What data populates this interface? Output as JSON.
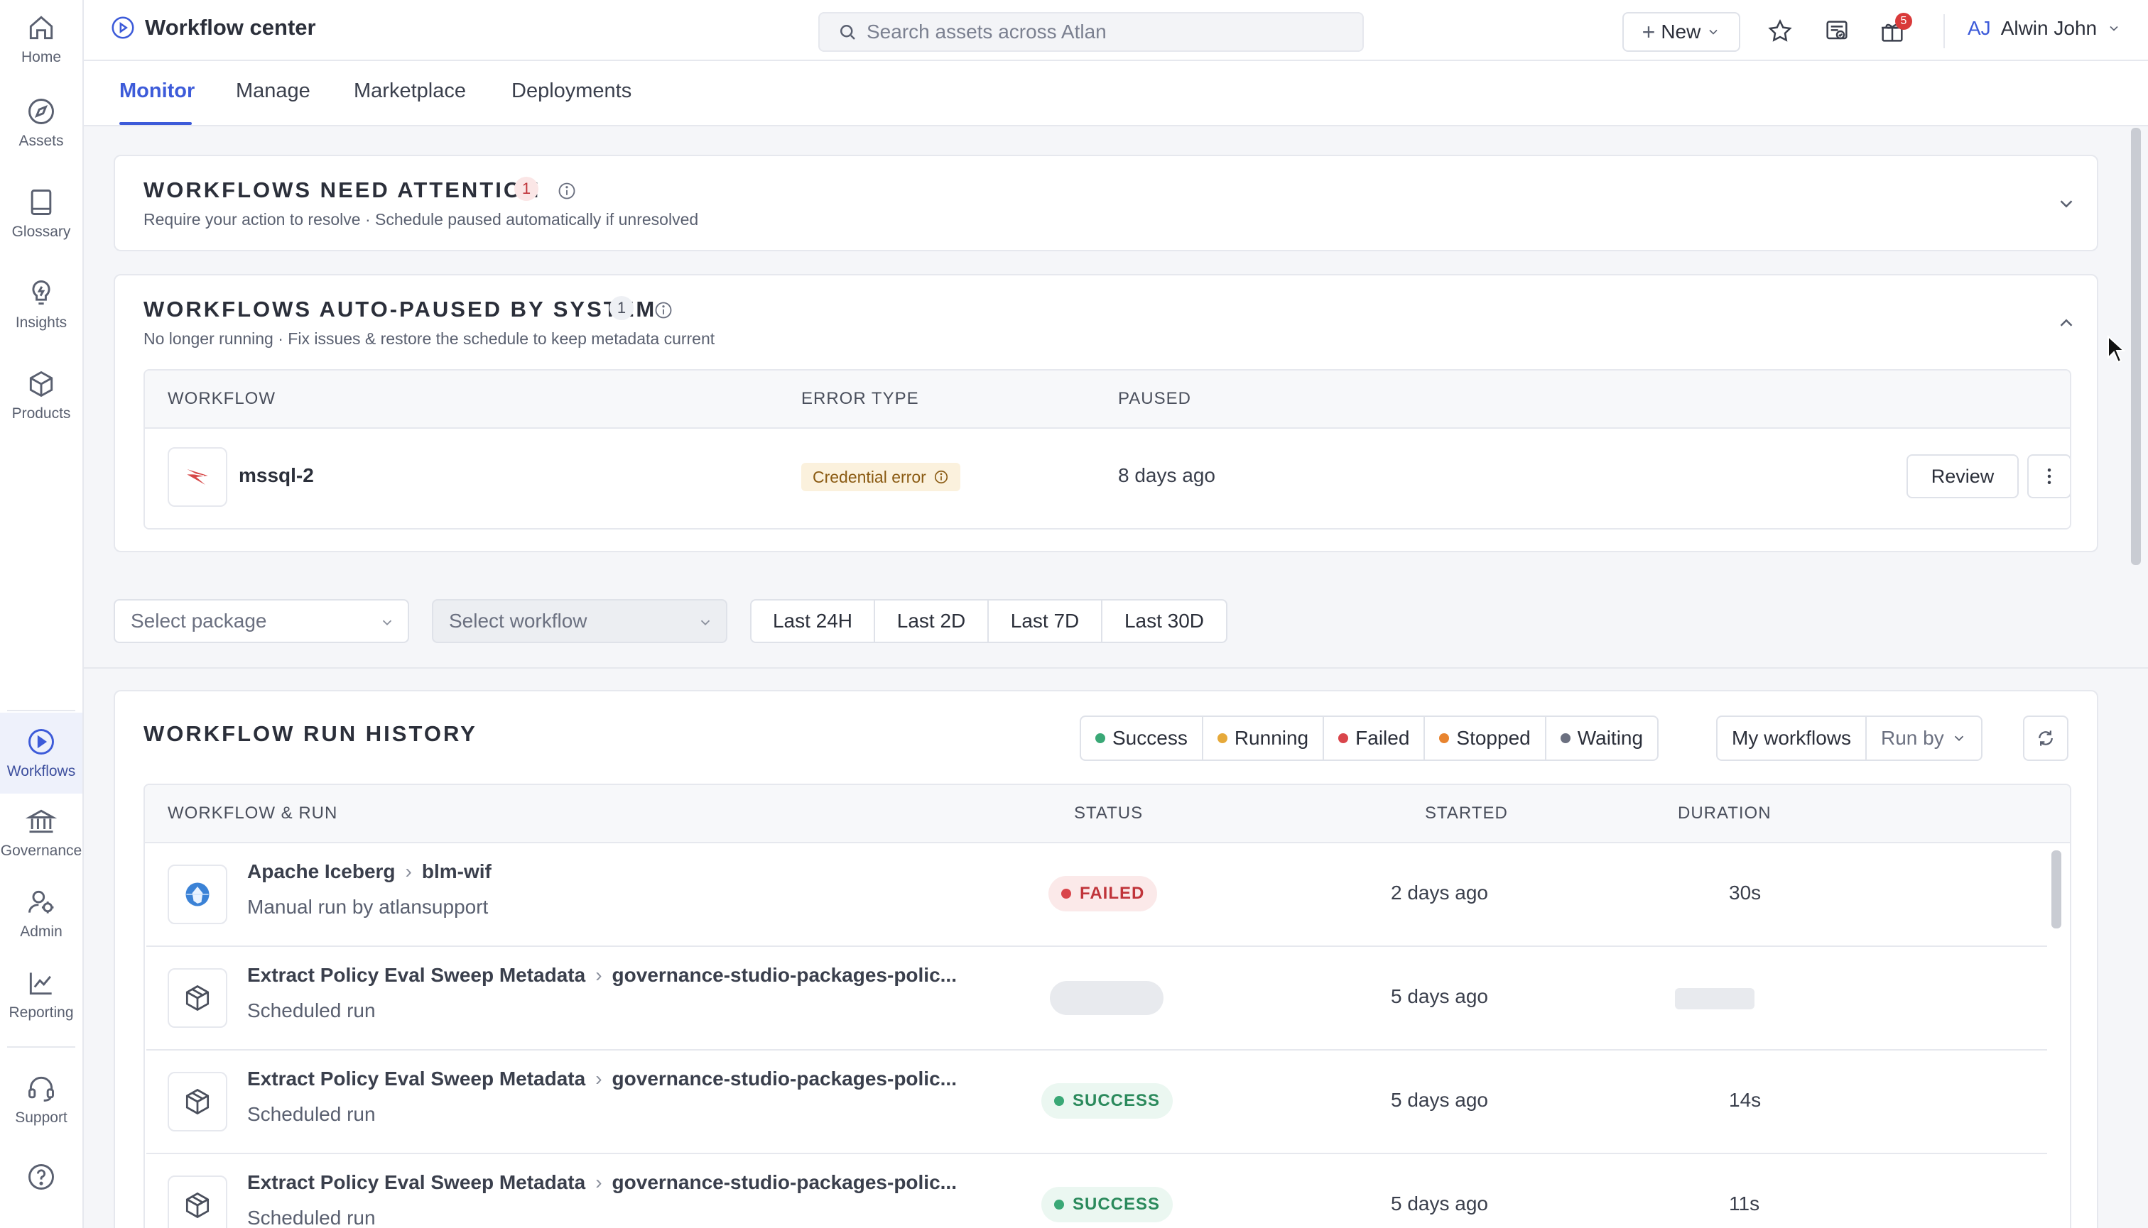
{
  "nav": {
    "top": [
      {
        "label": "Home",
        "icon": "home-icon"
      },
      {
        "label": "Assets",
        "icon": "compass-icon"
      },
      {
        "label": "Glossary",
        "icon": "book-icon"
      },
      {
        "label": "Insights",
        "icon": "lightbulb-icon"
      },
      {
        "label": "Products",
        "icon": "cube-icon"
      }
    ],
    "bottom": [
      {
        "label": "Workflows",
        "icon": "play-circle-icon",
        "active": true
      },
      {
        "label": "Governance",
        "icon": "bank-icon"
      },
      {
        "label": "Admin",
        "icon": "admin-icon"
      },
      {
        "label": "Reporting",
        "icon": "chart-line-icon"
      },
      {
        "label": "Support",
        "icon": "headset-icon"
      }
    ]
  },
  "header": {
    "title": "Workflow center",
    "search_placeholder": "Search assets across Atlan",
    "new_label": "New",
    "notification_count": "5",
    "user_initials": "AJ",
    "user_name": "Alwin John"
  },
  "tabs": [
    {
      "label": "Monitor",
      "active": true
    },
    {
      "label": "Manage"
    },
    {
      "label": "Marketplace"
    },
    {
      "label": "Deployments"
    }
  ],
  "attention": {
    "title": "WORKFLOWS NEED ATTENTION",
    "count": "1",
    "subtitle": "Require your action to resolve · Schedule paused automatically if unresolved"
  },
  "auto_paused": {
    "title": "WORKFLOWS AUTO-PAUSED BY SYSTEM",
    "count": "1",
    "subtitle": "No longer running · Fix issues & restore the schedule to keep metadata current",
    "columns": {
      "workflow": "WORKFLOW",
      "error": "ERROR TYPE",
      "paused": "PAUSED"
    },
    "row": {
      "name": "mssql-2",
      "error": "Credential error",
      "paused": "8 days ago",
      "action": "Review"
    }
  },
  "filters": {
    "package_placeholder": "Select package",
    "workflow_placeholder": "Select workflow",
    "ranges": [
      "Last 24H",
      "Last 2D",
      "Last 7D",
      "Last 30D"
    ]
  },
  "run_history": {
    "title": "WORKFLOW RUN HISTORY",
    "legend": [
      {
        "label": "Success",
        "color": "#3aa876"
      },
      {
        "label": "Running",
        "color": "#e6a93a"
      },
      {
        "label": "Failed",
        "color": "#d9454b"
      },
      {
        "label": "Stopped",
        "color": "#e8842f"
      },
      {
        "label": "Waiting",
        "color": "#6b7080"
      }
    ],
    "my_workflows": "My workflows",
    "run_by": "Run by",
    "columns": {
      "workflow": "WORKFLOW & RUN",
      "status": "STATUS",
      "started": "STARTED",
      "duration": "DURATION"
    },
    "rows": [
      {
        "package": "Apache Iceberg",
        "run": "blm-wif",
        "sub": "Manual run by atlansupport",
        "status": "FAILED",
        "started": "2 days ago",
        "duration": "30s",
        "icon": "iceberg-icon"
      },
      {
        "package": "Extract Policy Eval Sweep Metadata",
        "run": "governance-studio-packages-polic...",
        "sub": "Scheduled run",
        "status": "",
        "started": "5 days ago",
        "duration": "",
        "icon": "package-icon"
      },
      {
        "package": "Extract Policy Eval Sweep Metadata",
        "run": "governance-studio-packages-polic...",
        "sub": "Scheduled run",
        "status": "SUCCESS",
        "started": "5 days ago",
        "duration": "14s",
        "icon": "package-icon"
      },
      {
        "package": "Extract Policy Eval Sweep Metadata",
        "run": "governance-studio-packages-polic...",
        "sub": "Scheduled run",
        "status": "SUCCESS",
        "started": "5 days ago",
        "duration": "11s",
        "icon": "package-icon"
      }
    ]
  }
}
